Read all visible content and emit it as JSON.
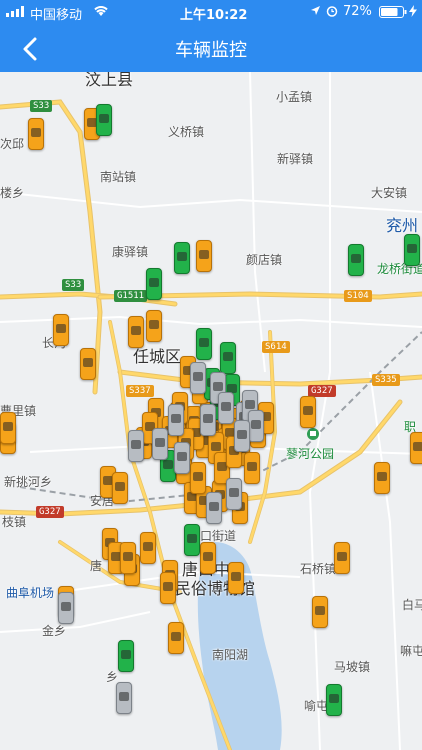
{
  "status_bar": {
    "carrier": "中国移动",
    "time": "上午10:22",
    "battery": "72%"
  },
  "nav": {
    "title": "车辆监控"
  },
  "places": [
    "汶上县",
    "小孟镇",
    "义桥镇",
    "次邱",
    "南站镇",
    "新驿镇",
    "楼乡",
    "康驿镇",
    "颜店镇",
    "大安镇",
    "兖州",
    "龙桥街道",
    "长沟",
    "任城区",
    "喻屯镇",
    "南阳湖",
    "唐口中",
    "民俗博物馆",
    "石桥镇",
    "安居",
    "金乡",
    "马坡镇",
    "曲阜机场",
    "蓼河公园",
    "新挑河乡",
    "曹里镇",
    "白马",
    "职",
    "唐口街道",
    "唐",
    "嘛屯镇",
    "乡",
    "枝镇"
  ],
  "roads": [
    "S33",
    "S33",
    "G1511",
    "S104",
    "S614",
    "S337",
    "G327",
    "S335",
    "G327"
  ],
  "cars": {
    "orange": 58,
    "green": 14,
    "gray": 16
  },
  "colors": {
    "nav": "#2d8bf0",
    "orange_car": "#f5a31a",
    "green_car": "#22b24a",
    "gray_car": "#b7bcc2"
  }
}
